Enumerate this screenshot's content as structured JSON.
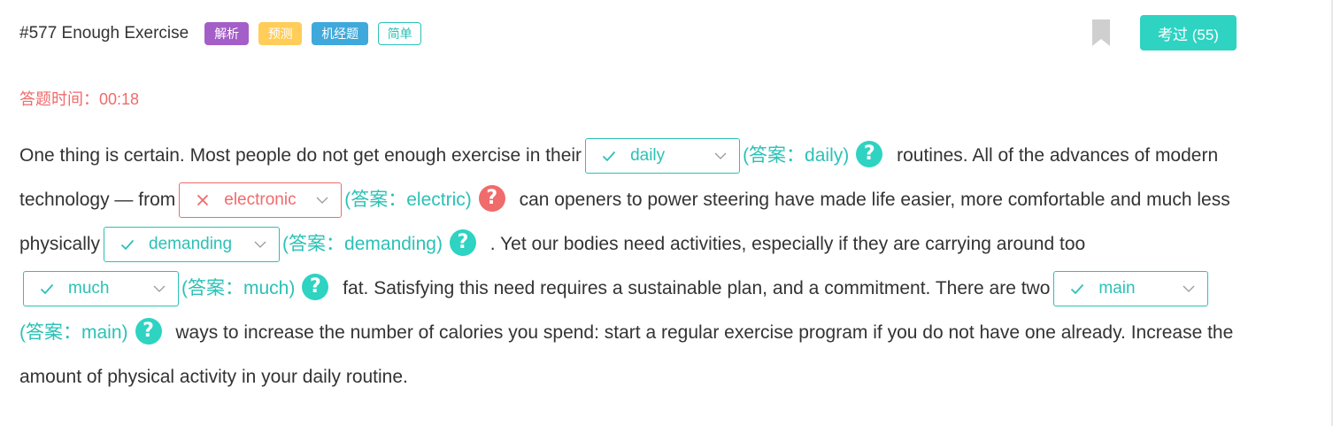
{
  "header": {
    "title": "#577 Enough Exercise",
    "tags": [
      "解析",
      "预测",
      "机经题",
      "简单"
    ],
    "exam_button": "考过 (55)"
  },
  "timer": {
    "label": "答题时间：",
    "value": "00:18"
  },
  "passage": {
    "segments": [
      "One thing is certain. Most people do not get enough exercise in their",
      "routines. All of the advances of modern technology — from",
      "can openers to power steering have made life easier, more comfortable and much less physically",
      ". Yet our bodies need activities, especially if they are carrying around too",
      "fat. Satisfying this need requires a sustainable plan, and a commitment. There are two",
      "ways to increase the number of calories you spend: start a regular exercise program if you do not have one already. Increase the amount of physical activity in your daily routine."
    ],
    "blanks": [
      {
        "selected": "daily",
        "answer": "(答案：daily)",
        "correct": true
      },
      {
        "selected": "electronic",
        "answer": "(答案：electric)",
        "correct": false
      },
      {
        "selected": "demanding",
        "answer": "(答案：demanding)",
        "correct": true
      },
      {
        "selected": "much",
        "answer": "(答案：much)",
        "correct": true
      },
      {
        "selected": "main",
        "answer": "(答案：main)",
        "correct": true
      }
    ],
    "help_glyph": "?"
  },
  "colors": {
    "accent": "#2ed3c2",
    "correct_text": "#2bc1b6",
    "wrong": "#f06b6b",
    "tag_purple": "#a45ec7",
    "tag_yellow": "#ffcd58",
    "tag_blue": "#3fa9db",
    "bookmark": "#cfcfcf"
  },
  "icons": {
    "bookmark": "bookmark-icon",
    "correct": "check-icon",
    "wrong": "cross-icon",
    "dropdown": "chevron-down-icon",
    "help": "question-circle-icon"
  }
}
